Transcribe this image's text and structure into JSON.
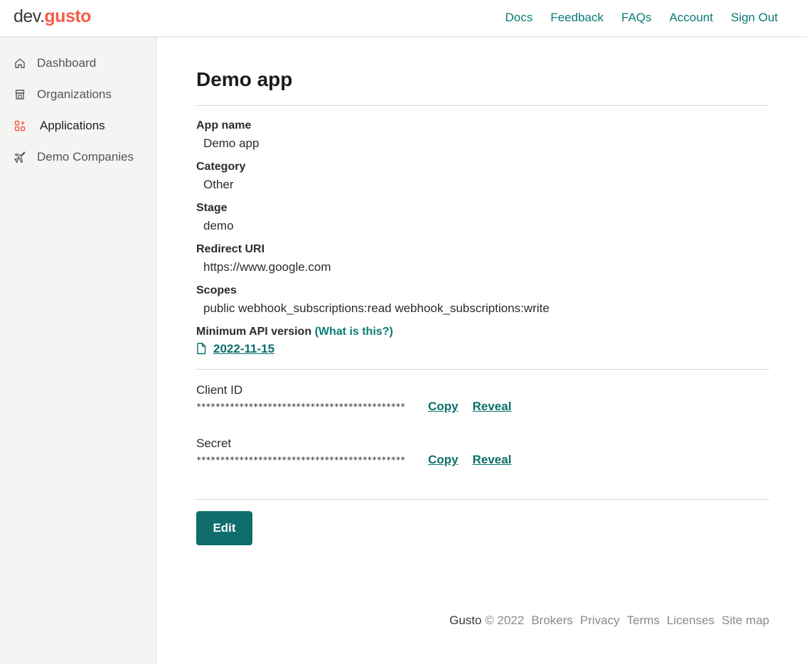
{
  "header": {
    "logo_dev": "dev.",
    "logo_gusto": "gusto",
    "nav": [
      "Docs",
      "Feedback",
      "FAQs",
      "Account",
      "Sign Out"
    ]
  },
  "sidebar": {
    "items": [
      {
        "label": "Dashboard",
        "icon": "home-icon"
      },
      {
        "label": "Organizations",
        "icon": "storefront-icon"
      },
      {
        "label": "Applications",
        "icon": "apps-grid-icon",
        "active": true
      },
      {
        "label": "Demo Companies",
        "icon": "airplane-icon"
      }
    ]
  },
  "main": {
    "title": "Demo app",
    "fields": {
      "app_name": {
        "label": "App name",
        "value": "Demo app"
      },
      "category": {
        "label": "Category",
        "value": "Other"
      },
      "stage": {
        "label": "Stage",
        "value": "demo"
      },
      "redirect_uri": {
        "label": "Redirect URI",
        "value": "https://www.google.com"
      },
      "scopes": {
        "label": "Scopes",
        "value": "public webhook_subscriptions:read webhook_subscriptions:write"
      },
      "min_api": {
        "label": "Minimum API version",
        "help": "(What is this?)",
        "value": "2022-11-15"
      }
    },
    "credentials": {
      "client_id": {
        "label": "Client ID",
        "masked": "********************************************",
        "copy": "Copy",
        "reveal": "Reveal"
      },
      "secret": {
        "label": "Secret",
        "masked": "********************************************",
        "copy": "Copy",
        "reveal": "Reveal"
      }
    },
    "edit_label": "Edit"
  },
  "footer": {
    "brand": "Gusto",
    "copyright": "© 2022",
    "links": [
      "Brokers",
      "Privacy",
      "Terms",
      "Licenses",
      "Site map"
    ]
  },
  "colors": {
    "accent": "#0a7b76",
    "brand": "#f45d48",
    "button": "#0f6e6b",
    "sidebar_bg": "#f4f4f3"
  }
}
